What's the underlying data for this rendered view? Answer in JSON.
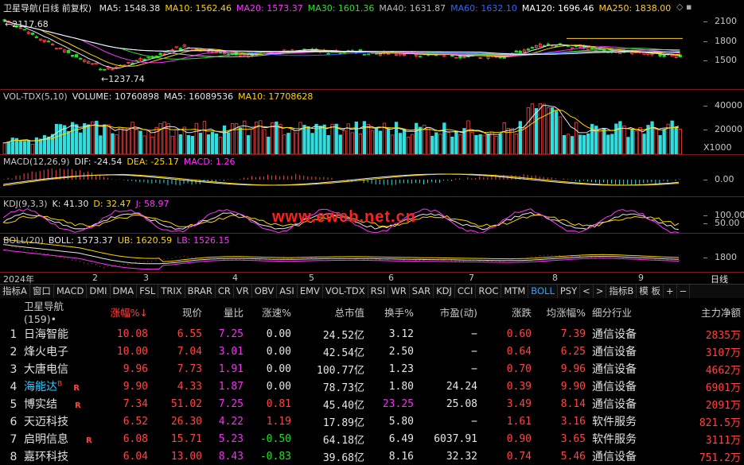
{
  "colors": {
    "up": "#ff4444",
    "down": "#22dd22",
    "bg": "#000000",
    "grid": "#7a1a1a",
    "ma5": "#e6e6e6",
    "ma10": "#ffd400",
    "ma20": "#ff33ff",
    "ma30": "#33dd33",
    "ma40": "#bbbbbb",
    "ma60": "#3366ff",
    "ma120": "#ffffff",
    "ma250": "#ffcc33"
  },
  "kline": {
    "title": "卫星导航(日线 前复权)",
    "ma": [
      {
        "label": "MA5: 1548.38",
        "color": "#e6e6e6"
      },
      {
        "label": "MA10: 1562.46",
        "color": "#ffd400"
      },
      {
        "label": "MA20: 1573.37",
        "color": "#ff33ff"
      },
      {
        "label": "MA30: 1601.36",
        "color": "#33dd33"
      },
      {
        "label": "MA40: 1631.87",
        "color": "#bbbbbb"
      },
      {
        "label": "MA60: 1632.10",
        "color": "#3366ff"
      },
      {
        "label": "MA120: 1696.46",
        "color": "#ffffff"
      },
      {
        "label": "MA250: 1838.00",
        "color": "#ffcc33"
      }
    ],
    "high_label": "2117.68",
    "low_label": "1237.74",
    "axis": [
      "2100",
      "1800",
      "1500"
    ]
  },
  "vol": {
    "header": [
      {
        "label": "VOL-TDX(5,10)",
        "color": "#c8c8c8"
      },
      {
        "label": "VOLUME: 10760898",
        "color": "#e6e6e6"
      },
      {
        "label": "MA5: 16089536",
        "color": "#e6e6e6"
      },
      {
        "label": "MA10: 17708628",
        "color": "#ffd400"
      }
    ],
    "axis": [
      "40000",
      "20000"
    ],
    "unit": "X1000"
  },
  "macd": {
    "header": [
      {
        "label": "MACD(12,26,9)",
        "color": "#c8c8c8"
      },
      {
        "label": "DIF: -24.54",
        "color": "#e6e6e6"
      },
      {
        "label": "DEA: -25.17",
        "color": "#ffd400"
      },
      {
        "label": "MACD: 1.26",
        "color": "#ff33ff"
      }
    ],
    "axis": [
      "0.00"
    ]
  },
  "kdj": {
    "header": [
      {
        "label": "KDJ(9,3,3)",
        "color": "#c8c8c8"
      },
      {
        "label": "K: 41.30",
        "color": "#e6e6e6"
      },
      {
        "label": "D: 32.47",
        "color": "#ffd400"
      },
      {
        "label": "J: 58.97",
        "color": "#ff33ff"
      }
    ],
    "axis": [
      "100.00",
      "50.00"
    ]
  },
  "boll": {
    "header": [
      {
        "label": "BOLL(20)",
        "color": "#c8c8c8"
      },
      {
        "label": "BOLL: 1573.37",
        "color": "#e6e6e6"
      },
      {
        "label": "UB: 1620.59",
        "color": "#ffd400"
      },
      {
        "label": "LB: 1526.15",
        "color": "#ff33ff"
      }
    ],
    "axis": [
      "1800"
    ]
  },
  "dates": {
    "year": "2024年",
    "months": [
      "2",
      "3",
      "4",
      "5",
      "6",
      "7",
      "8",
      "9"
    ],
    "period": "日线"
  },
  "watermark": "www.eweb.net.cn",
  "tabs": [
    "指标A",
    "窗口",
    "MACD",
    "DMI",
    "DMA",
    "FSL",
    "TRIX",
    "BRAR",
    "CR",
    "VR",
    "OBV",
    "ASI",
    "EMV",
    "VOL-TDX",
    "RSI",
    "WR",
    "SAR",
    "KDJ",
    "CCI",
    "ROC",
    "MTM",
    "BOLL",
    "PSY",
    "<",
    ">",
    "指标B",
    "模 板",
    "+",
    "−"
  ],
  "active_tab": "BOLL",
  "table": {
    "columns": [
      "卫星导航(159)•",
      "涨幅%↓",
      "现价",
      "量比",
      "涨速%",
      "总市值",
      "换手%",
      "市盈(动)",
      "涨跌",
      "均涨幅%",
      "细分行业",
      "主力净额"
    ],
    "rows": [
      {
        "idx": "1",
        "name": "日海智能",
        "flag": "",
        "sup": "",
        "pct": "10.08",
        "price": "6.55",
        "vr": "7.25",
        "spd": "0.00",
        "mcap": "24.52亿",
        "turn": "3.12",
        "pe": "−",
        "chg": "0.60",
        "avg": "7.39",
        "ind": "通信设备",
        "net": "2835万",
        "name_color": "#e0e0e0",
        "spd_color": "#e6e6e6"
      },
      {
        "idx": "2",
        "name": "烽火电子",
        "flag": "",
        "sup": "",
        "pct": "10.00",
        "price": "7.04",
        "vr": "3.01",
        "spd": "0.00",
        "mcap": "42.54亿",
        "turn": "2.50",
        "pe": "−",
        "chg": "0.64",
        "avg": "6.25",
        "ind": "通信设备",
        "net": "3107万",
        "name_color": "#e0e0e0",
        "spd_color": "#e6e6e6"
      },
      {
        "idx": "3",
        "name": "大唐电信",
        "flag": "",
        "sup": "",
        "pct": "9.96",
        "price": "7.73",
        "vr": "1.91",
        "spd": "0.00",
        "mcap": "100.77亿",
        "turn": "1.23",
        "pe": "−",
        "chg": "0.70",
        "avg": "9.96",
        "ind": "通信设备",
        "net": "4662万",
        "name_color": "#e0e0e0",
        "spd_color": "#e6e6e6"
      },
      {
        "idx": "4",
        "name": "海能达",
        "flag": "R",
        "sup": "B",
        "pct": "9.90",
        "price": "4.33",
        "vr": "1.87",
        "spd": "0.00",
        "mcap": "78.73亿",
        "turn": "1.80",
        "pe": "24.24",
        "chg": "0.39",
        "avg": "9.90",
        "ind": "通信设备",
        "net": "6901万",
        "name_color": "#33ccff",
        "spd_color": "#e6e6e6"
      },
      {
        "idx": "5",
        "name": "博实结",
        "flag": "R",
        "sup": "",
        "pct": "7.34",
        "price": "51.02",
        "vr": "7.25",
        "spd": "0.81",
        "mcap": "45.40亿",
        "turn": "23.25",
        "pe": "25.08",
        "chg": "3.49",
        "avg": "8.14",
        "ind": "通信设备",
        "net": "2091万",
        "name_color": "#e0e0e0",
        "spd_color": "#ff4444"
      },
      {
        "idx": "6",
        "name": "天迈科技",
        "flag": "",
        "sup": "",
        "pct": "6.52",
        "price": "26.30",
        "vr": "4.22",
        "spd": "1.19",
        "mcap": "17.89亿",
        "turn": "5.80",
        "pe": "−",
        "chg": "1.61",
        "avg": "3.16",
        "ind": "软件服务",
        "net": "821.5万",
        "name_color": "#e0e0e0",
        "spd_color": "#ff4444"
      },
      {
        "idx": "7",
        "name": "启明信息",
        "flag": "R",
        "sup": "",
        "pct": "6.08",
        "price": "15.71",
        "vr": "5.23",
        "spd": "-0.50",
        "mcap": "64.18亿",
        "turn": "6.49",
        "pe": "6037.91",
        "chg": "0.90",
        "avg": "3.65",
        "ind": "软件服务",
        "net": "3111万",
        "name_color": "#e0e0e0",
        "spd_color": "#22dd22"
      },
      {
        "idx": "8",
        "name": "嘉环科技",
        "flag": "",
        "sup": "",
        "pct": "6.04",
        "price": "13.00",
        "vr": "8.43",
        "spd": "-0.83",
        "mcap": "39.68亿",
        "turn": "8.16",
        "pe": "32.32",
        "chg": "0.74",
        "avg": "5.46",
        "ind": "通信设备",
        "net": "751.2万",
        "name_color": "#e0e0e0",
        "spd_color": "#22dd22"
      }
    ]
  }
}
